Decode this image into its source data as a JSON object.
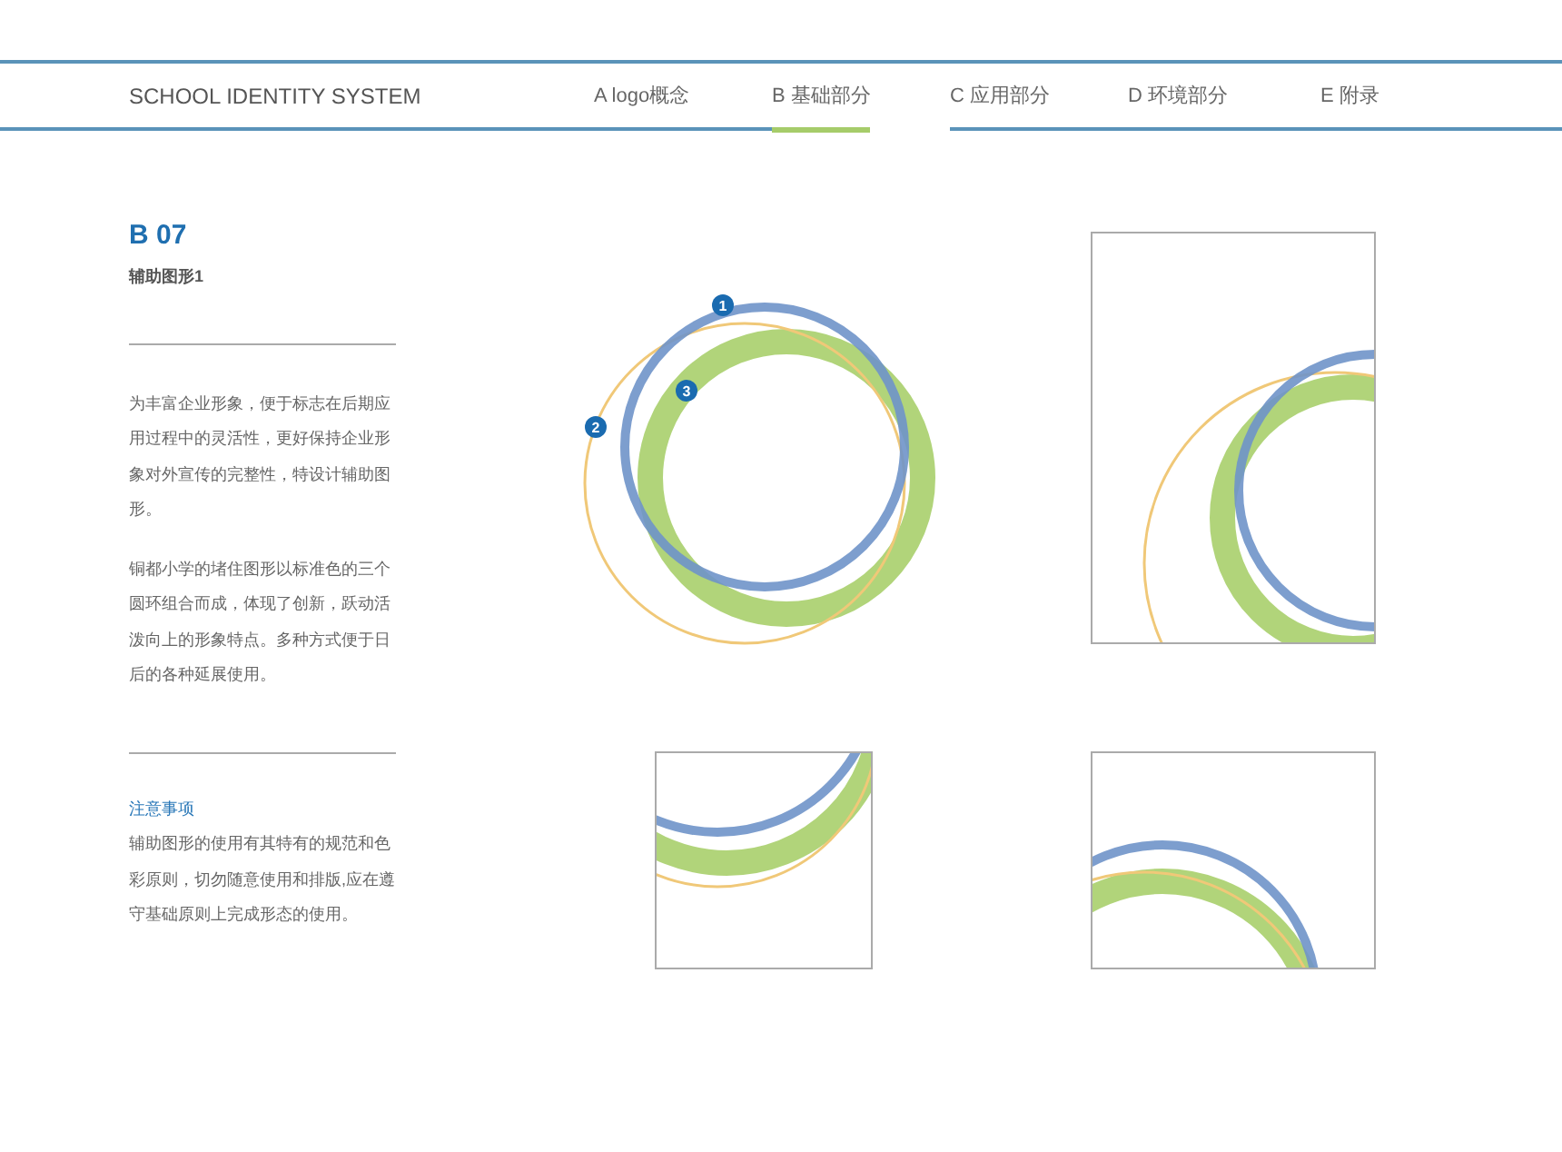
{
  "header": {
    "title": "SCHOOL IDENTITY SYSTEM"
  },
  "tabs": [
    {
      "label": "A logo概念",
      "selected": false
    },
    {
      "label": "B 基础部分",
      "selected": true
    },
    {
      "label": "C 应用部分",
      "selected": false
    },
    {
      "label": "D 环境部分",
      "selected": false
    },
    {
      "label": "E 附录",
      "selected": false
    }
  ],
  "section": {
    "code": "B 07",
    "title": "辅助图形1",
    "paragraphs": [
      "为丰富企业形象，便于标志在后期应用过程中的灵活性，更好保持企业形象对外宣传的完整性，特设计辅助图形。",
      "铜都小学的堵住图形以标准色的三个圆环组合而成，体现了创新，跃动活泼向上的形象特点。多种方式便于日后的各种延展使用。"
    ],
    "notes_heading": "注意事项",
    "notes": "辅助图形的使用有其特有的规范和色彩原则，切勿随意使用和排版,应在遵守基础原则上完成形态的使用。"
  },
  "badges": [
    "1",
    "2",
    "3"
  ]
}
